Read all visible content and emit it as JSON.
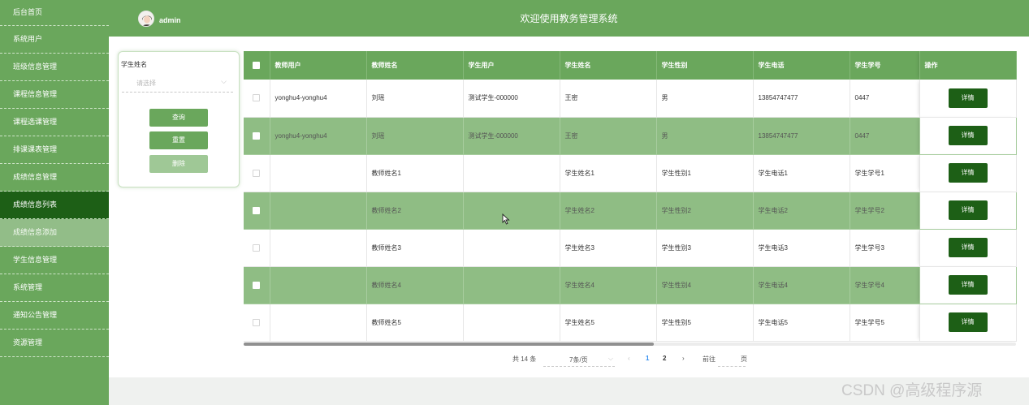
{
  "header": {
    "username": "admin",
    "title": "欢迎使用教务管理系统"
  },
  "sidebar": {
    "items": [
      {
        "label": "后台首页"
      },
      {
        "label": "系统用户"
      },
      {
        "label": "班级信息管理"
      },
      {
        "label": "课程信息管理"
      },
      {
        "label": "课程选课管理"
      },
      {
        "label": "排课课表管理"
      },
      {
        "label": "成绩信息管理"
      },
      {
        "label": "成绩信息列表",
        "active": true
      },
      {
        "label": "成绩信息添加",
        "sub": true
      },
      {
        "label": "学生信息管理"
      },
      {
        "label": "系统管理"
      },
      {
        "label": "通知公告管理"
      },
      {
        "label": "资源管理"
      }
    ]
  },
  "search": {
    "field_label": "学生姓名",
    "placeholder": "请选择",
    "query_label": "查询",
    "reset_label": "重置",
    "delete_label": "删除"
  },
  "table": {
    "columns": [
      "教师用户",
      "教师姓名",
      "学生用户",
      "学生姓名",
      "学生性别",
      "学生电话",
      "学生学号",
      "操作"
    ],
    "rows": [
      {
        "teacher_user": "yonghu4-yonghu4",
        "teacher_name": "刘瑶",
        "student_user": "测试学生-000000",
        "student_name": "王密",
        "gender": "男",
        "phone": "13854747477",
        "student_no": "0447",
        "action": "详情"
      },
      {
        "teacher_user": "yonghu4-yonghu4",
        "teacher_name": "刘瑶",
        "student_user": "测试学生-000000",
        "student_name": "王密",
        "gender": "男",
        "phone": "13854747477",
        "student_no": "0447",
        "action": "详情"
      },
      {
        "teacher_user": "",
        "teacher_name": "教师姓名1",
        "student_user": "",
        "student_name": "学生姓名1",
        "gender": "学生性别1",
        "phone": "学生电话1",
        "student_no": "学生学号1",
        "action": "详情"
      },
      {
        "teacher_user": "",
        "teacher_name": "教师姓名2",
        "student_user": "",
        "student_name": "学生姓名2",
        "gender": "学生性别2",
        "phone": "学生电话2",
        "student_no": "学生学号2",
        "action": "详情"
      },
      {
        "teacher_user": "",
        "teacher_name": "教师姓名3",
        "student_user": "",
        "student_name": "学生姓名3",
        "gender": "学生性别3",
        "phone": "学生电话3",
        "student_no": "学生学号3",
        "action": "详情"
      },
      {
        "teacher_user": "",
        "teacher_name": "教师姓名4",
        "student_user": "",
        "student_name": "学生姓名4",
        "gender": "学生性别4",
        "phone": "学生电话4",
        "student_no": "学生学号4",
        "action": "详情"
      },
      {
        "teacher_user": "",
        "teacher_name": "教师姓名5",
        "student_user": "",
        "student_name": "学生姓名5",
        "gender": "学生性别5",
        "phone": "学生电话5",
        "student_no": "学生学号5",
        "action": "详情"
      }
    ]
  },
  "pagination": {
    "total": "共 14 条",
    "page_size": "7条/页",
    "prev": "‹",
    "page1": "1",
    "page2": "2",
    "next": "›",
    "goto": "前往",
    "page_unit": "页"
  },
  "watermark": "CSDN @高级程序源",
  "colors": {
    "primary": "#6aa75c",
    "active": "#1d5f16",
    "row_alt": "#8fbd84"
  }
}
